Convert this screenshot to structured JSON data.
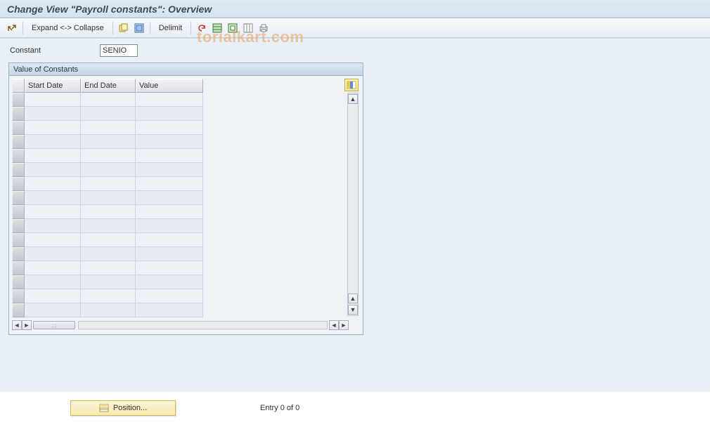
{
  "header": {
    "title": "Change View \"Payroll constants\": Overview"
  },
  "toolbar": {
    "expand_collapse": "Expand <-> Collapse",
    "delimit": "Delimit"
  },
  "form": {
    "constant_label": "Constant",
    "constant_value": "SENIO"
  },
  "panel": {
    "title": "Value of Constants",
    "columns": {
      "start_date": "Start Date",
      "end_date": "End Date",
      "value": "Value"
    },
    "row_count": 16
  },
  "footer": {
    "position_label": "Position...",
    "entry_text": "Entry 0 of 0"
  },
  "watermark": "torialkart.com"
}
